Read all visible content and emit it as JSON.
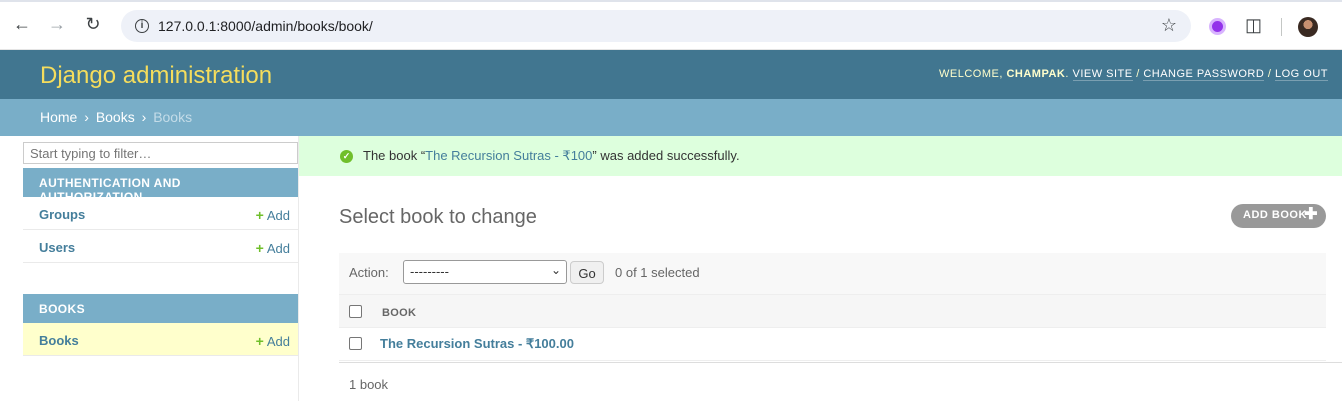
{
  "browser": {
    "url": "127.0.0.1:8000/admin/books/book/",
    "icons": [
      "back-icon",
      "forward-icon",
      "reload-icon",
      "site-info-icon",
      "bookmark-star-icon",
      "extension-icon",
      "puzzle-icon",
      "profile-avatar"
    ]
  },
  "header": {
    "branding": "Django administration",
    "welcome": "Welcome,",
    "username": "Champak",
    "view_site": "View site",
    "change_password": "Change password",
    "log_out": "Log out",
    "separator": "/"
  },
  "breadcrumbs": {
    "home": "Home",
    "app": "Books",
    "current": "Books",
    "separator": "›"
  },
  "sidebar": {
    "filter_placeholder": "Start typing to filter…",
    "modules": [
      {
        "caption": "Authentication and Authorization",
        "models": [
          {
            "name": "Groups",
            "add": "Add"
          },
          {
            "name": "Users",
            "add": "Add"
          }
        ]
      },
      {
        "caption": "Books",
        "models": [
          {
            "name": "Books",
            "add": "Add",
            "current": true
          }
        ]
      }
    ]
  },
  "message": {
    "prefix": "The book “",
    "link_text": "The Recursion Sutras - ₹100",
    "suffix": "” was added successfully."
  },
  "content": {
    "title": "Select book to change",
    "add_button": "Add book",
    "action_label": "Action:",
    "action_selected": "---------",
    "go_button": "Go",
    "selected_counter": "0 of 1 selected",
    "column_header": "Book",
    "rows": [
      {
        "title": "The Recursion Sutras - ₹100.00"
      }
    ],
    "paginator": "1 book"
  },
  "colors": {
    "header_bg": "#417690",
    "branding": "#f5dd5d",
    "breadcrumb_bg": "#79aec8",
    "link": "#447e9b",
    "success_bg": "#ddffdd",
    "add_green": "#70bf2b",
    "current_row": "#ffffcc"
  }
}
